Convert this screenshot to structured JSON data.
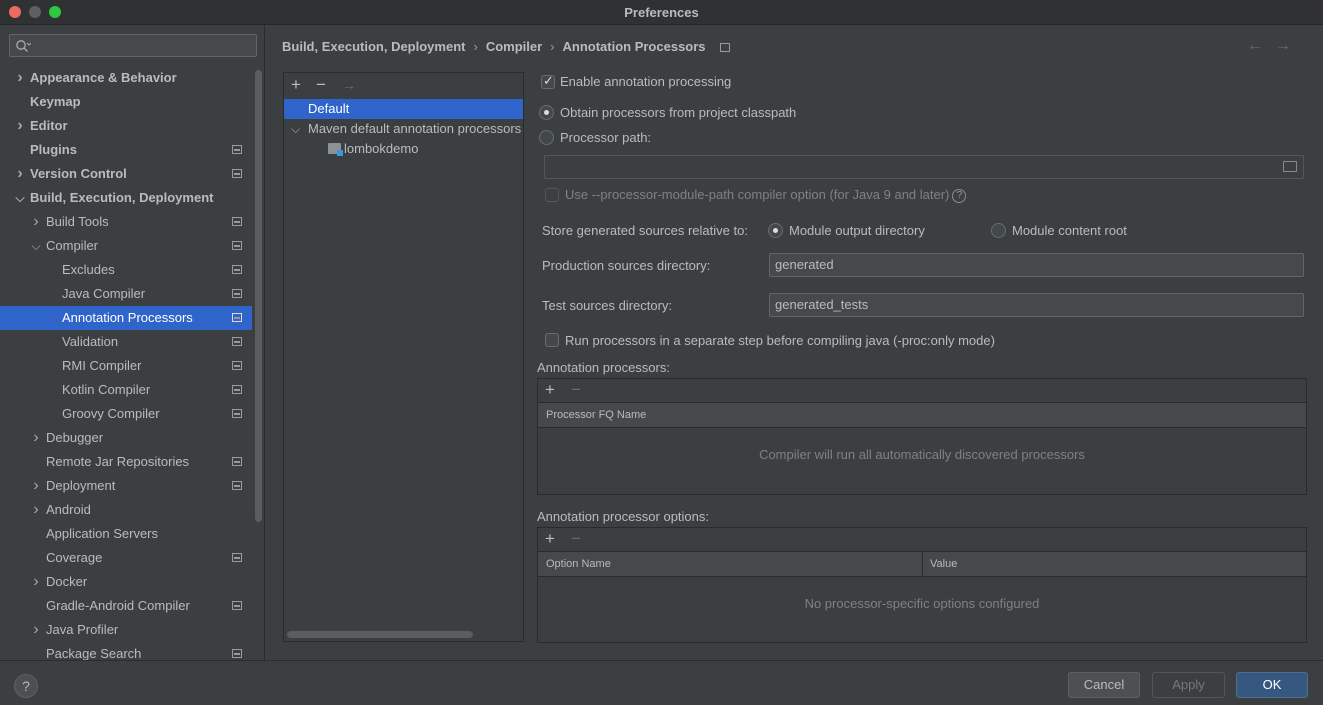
{
  "window": {
    "title": "Preferences"
  },
  "search": {
    "placeholder": ""
  },
  "sidebar": {
    "items": [
      {
        "label": "Appearance & Behavior",
        "level": 0,
        "expander": "collapsed",
        "bold": true,
        "project": false
      },
      {
        "label": "Keymap",
        "level": 0,
        "expander": "none",
        "bold": true,
        "project": false
      },
      {
        "label": "Editor",
        "level": 0,
        "expander": "collapsed",
        "bold": true,
        "project": false
      },
      {
        "label": "Plugins",
        "level": 0,
        "expander": "none",
        "bold": true,
        "project": true
      },
      {
        "label": "Version Control",
        "level": 0,
        "expander": "collapsed",
        "bold": true,
        "project": true
      },
      {
        "label": "Build, Execution, Deployment",
        "level": 0,
        "expander": "expanded",
        "bold": true,
        "project": false
      },
      {
        "label": "Build Tools",
        "level": 1,
        "expander": "collapsed",
        "bold": false,
        "project": true
      },
      {
        "label": "Compiler",
        "level": 1,
        "expander": "expanded",
        "bold": false,
        "project": true
      },
      {
        "label": "Excludes",
        "level": 2,
        "expander": "none",
        "bold": false,
        "project": true
      },
      {
        "label": "Java Compiler",
        "level": 2,
        "expander": "none",
        "bold": false,
        "project": true
      },
      {
        "label": "Annotation Processors",
        "level": 2,
        "expander": "none",
        "bold": false,
        "project": true,
        "selected": true
      },
      {
        "label": "Validation",
        "level": 2,
        "expander": "none",
        "bold": false,
        "project": true
      },
      {
        "label": "RMI Compiler",
        "level": 2,
        "expander": "none",
        "bold": false,
        "project": true
      },
      {
        "label": "Kotlin Compiler",
        "level": 2,
        "expander": "none",
        "bold": false,
        "project": true
      },
      {
        "label": "Groovy Compiler",
        "level": 2,
        "expander": "none",
        "bold": false,
        "project": true
      },
      {
        "label": "Debugger",
        "level": 1,
        "expander": "collapsed",
        "bold": false,
        "project": false
      },
      {
        "label": "Remote Jar Repositories",
        "level": 1,
        "expander": "none",
        "bold": false,
        "project": true
      },
      {
        "label": "Deployment",
        "level": 1,
        "expander": "collapsed",
        "bold": false,
        "project": true
      },
      {
        "label": "Android",
        "level": 1,
        "expander": "collapsed",
        "bold": false,
        "project": false
      },
      {
        "label": "Application Servers",
        "level": 1,
        "expander": "none",
        "bold": false,
        "project": false
      },
      {
        "label": "Coverage",
        "level": 1,
        "expander": "none",
        "bold": false,
        "project": true
      },
      {
        "label": "Docker",
        "level": 1,
        "expander": "collapsed",
        "bold": false,
        "project": false
      },
      {
        "label": "Gradle-Android Compiler",
        "level": 1,
        "expander": "none",
        "bold": false,
        "project": true
      },
      {
        "label": "Java Profiler",
        "level": 1,
        "expander": "collapsed",
        "bold": false,
        "project": false
      },
      {
        "label": "Package Search",
        "level": 1,
        "expander": "none",
        "bold": false,
        "project": true
      }
    ]
  },
  "breadcrumb": {
    "parts": [
      "Build, Execution, Deployment",
      "Compiler",
      "Annotation Processors"
    ],
    "separator": "›"
  },
  "profiles": {
    "toolbar": {
      "add": "+",
      "remove": "−",
      "move": "→"
    },
    "default_label": "Default",
    "maven_label": "Maven default annotation processors profile",
    "module_label": "lombokdemo"
  },
  "settings": {
    "enable_processing": {
      "label": "Enable annotation processing",
      "checked": true
    },
    "obtain_classpath": {
      "label": "Obtain processors from project classpath",
      "selected": true
    },
    "processor_path": {
      "label": "Processor path:",
      "selected": false,
      "value": ""
    },
    "module_path_option": {
      "label": "Use --processor-module-path compiler option (for Java 9 and later)",
      "checked": false,
      "help": "?"
    },
    "store_generated_label": "Store generated sources relative to:",
    "module_output": {
      "label": "Module output directory",
      "selected": true
    },
    "module_content": {
      "label": "Module content root",
      "selected": false
    },
    "production_dir": {
      "label": "Production sources directory:",
      "value": "generated"
    },
    "test_dir": {
      "label": "Test sources directory:",
      "value": "generated_tests"
    },
    "separate_step": {
      "label": "Run processors in a separate step before compiling java (-proc:only mode)",
      "checked": false
    }
  },
  "processors_table": {
    "title": "Annotation processors:",
    "add": "+",
    "remove": "−",
    "column": "Processor FQ Name",
    "empty": "Compiler will run all automatically discovered processors"
  },
  "options_table": {
    "title": "Annotation processor options:",
    "add": "+",
    "remove": "−",
    "columns": [
      "Option Name",
      "Value"
    ],
    "empty": "No processor-specific options configured"
  },
  "buttons": {
    "help": "?",
    "cancel": "Cancel",
    "apply": "Apply",
    "ok": "OK"
  },
  "colors": {
    "selection": "#2f65ca",
    "ok_button": "#365880",
    "background": "#3c3f41"
  }
}
